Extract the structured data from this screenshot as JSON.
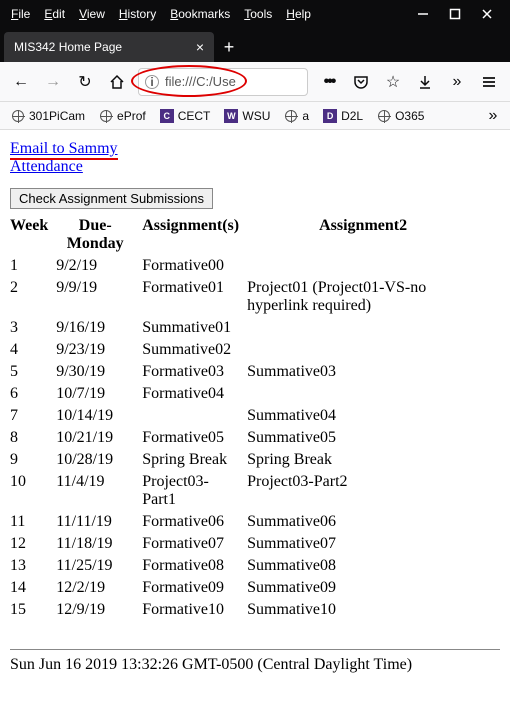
{
  "menu": [
    "File",
    "Edit",
    "View",
    "History",
    "Bookmarks",
    "Tools",
    "Help"
  ],
  "tab_title": "MIS342 Home Page",
  "url": "file:///C:/Use",
  "bookmarks": [
    {
      "label": "301PiCam",
      "icon": "globe"
    },
    {
      "label": "eProf",
      "icon": "globe"
    },
    {
      "label": "CECT",
      "icon": "sq"
    },
    {
      "label": "WSU",
      "icon": "sq"
    },
    {
      "label": "a",
      "icon": "globe"
    },
    {
      "label": "D2L",
      "icon": "sq"
    },
    {
      "label": "O365",
      "icon": "globe"
    }
  ],
  "links": {
    "email": "Email to Sammy",
    "attendance": "Attendance"
  },
  "button_label": "Check Assignment Submissions",
  "headers": [
    "Week",
    "Due-Monday",
    "Assignment(s)",
    "Assignment2"
  ],
  "rows": [
    {
      "w": "1",
      "d": "9/2/19",
      "a1": "Formative00",
      "a2": ""
    },
    {
      "w": "2",
      "d": "9/9/19",
      "a1": "Formative01",
      "a2": "Project01  (Project01-VS-no hyperlink required)"
    },
    {
      "w": "3",
      "d": "9/16/19",
      "a1": "Summative01",
      "a2": ""
    },
    {
      "w": "4",
      "d": "9/23/19",
      "a1": "Summative02",
      "a2": ""
    },
    {
      "w": "5",
      "d": "9/30/19",
      "a1": "Formative03",
      "a2": "Summative03"
    },
    {
      "w": "6",
      "d": "10/7/19",
      "a1": "Formative04",
      "a2": ""
    },
    {
      "w": "7",
      "d": "10/14/19",
      "a1": "",
      "a2": "Summative04"
    },
    {
      "w": "8",
      "d": "10/21/19",
      "a1": "Formative05",
      "a2": "Summative05"
    },
    {
      "w": "9",
      "d": "10/28/19",
      "a1": "Spring Break",
      "a2": "Spring Break"
    },
    {
      "w": "10",
      "d": "11/4/19",
      "a1": "Project03-Part1",
      "a2": "Project03-Part2"
    },
    {
      "w": "11",
      "d": "11/11/19",
      "a1": "Formative06",
      "a2": "Summative06"
    },
    {
      "w": "12",
      "d": "11/18/19",
      "a1": "Formative07",
      "a2": "Summative07"
    },
    {
      "w": "13",
      "d": "11/25/19",
      "a1": "Formative08",
      "a2": "Summative08"
    },
    {
      "w": "14",
      "d": "12/2/19",
      "a1": "Formative09",
      "a2": "Summative09"
    },
    {
      "w": "15",
      "d": "12/9/19",
      "a1": "Formative10",
      "a2": "Summative10"
    }
  ],
  "timestamp": "Sun Jun 16 2019 13:32:26 GMT-0500 (Central Daylight Time)"
}
